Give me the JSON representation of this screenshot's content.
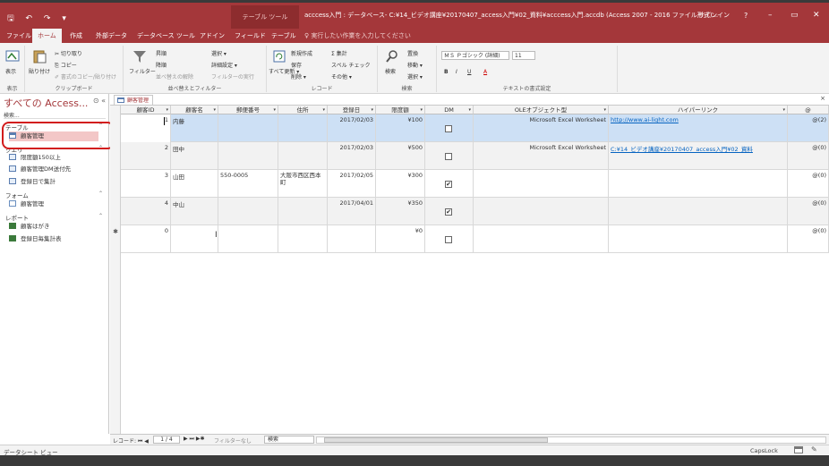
{
  "titlebar": {
    "qat": "🖫 ↶ ↷ ▾",
    "context_tool": "テーブル ツール",
    "title": "acccess入門 : データベース- C:¥14_ビデオ講座¥20170407_access入門¥02_資料¥acccess入門.accdb (Access 2007 - 2016 ファイル形式)...",
    "signin": "サインイン",
    "help": "?",
    "minimize": "–",
    "restore": "▭",
    "close": "✕"
  },
  "tabs": [
    {
      "label": "ファイル"
    },
    {
      "label": "ホーム"
    },
    {
      "label": "作成"
    },
    {
      "label": "外部データ"
    },
    {
      "label": "データベース ツール"
    },
    {
      "label": "アドイン"
    },
    {
      "label": "フィールド"
    },
    {
      "label": "テーブル"
    }
  ],
  "tell_me": "♀ 実行したい作業を入力してください",
  "ribbon": {
    "view": {
      "label": "表示",
      "group": "表示"
    },
    "clipboard": {
      "paste": "貼り付け",
      "cut": "✂ 切り取り",
      "copy": "⎘ コピー",
      "format_painter": "✐ 書式のコピー/貼り付け",
      "group": "クリップボード"
    },
    "sort_filter": {
      "filter": "フィルター",
      "asc": "昇順",
      "desc": "降順",
      "clear_sort": "並べ替えの解除",
      "selection": "選択 ▾",
      "advanced": "詳細設定 ▾",
      "toggle_filter": "フィルターの実行",
      "group": "並べ替えとフィルター"
    },
    "records": {
      "refresh": "すべて更新 ▾",
      "new": "新規作成",
      "save": "保存",
      "delete": "削除 ▾",
      "totals": "Σ 集計",
      "spelling": "スペル チェック",
      "more": "その他 ▾",
      "group": "レコード"
    },
    "find": {
      "find": "検索",
      "replace": "置換",
      "goto": "移動 ▾",
      "select": "選択 ▾",
      "group": "検索"
    },
    "text": {
      "font": "ＭＳ Ｐゴシック (詳細)",
      "size": "11",
      "bold": "B",
      "italic": "I",
      "underline": "U",
      "font_color": "A",
      "group": "テキストの書式設定"
    }
  },
  "nav": {
    "title": "すべての Access...",
    "ctl": "⊙ «",
    "search_placeholder": "検索...",
    "sections": [
      {
        "label": "テーブル",
        "chev": "⌃"
      },
      {
        "label": "クエリ",
        "chev": "⌃"
      },
      {
        "label": "フォーム",
        "chev": "⌃"
      },
      {
        "label": "レポート",
        "chev": "⌃"
      }
    ],
    "items": [
      {
        "label": "顧客管理"
      },
      {
        "label": "限度額150以上"
      },
      {
        "label": "顧客管理DM送付先"
      },
      {
        "label": "登録日で集計"
      },
      {
        "label": "顧客管理"
      },
      {
        "label": "顧客はがき"
      },
      {
        "label": "登録日毎集計表"
      }
    ]
  },
  "doc": {
    "tab": "顧客管理",
    "close": "×"
  },
  "table": {
    "columns": [
      {
        "label": "顧客ID"
      },
      {
        "label": "顧客名"
      },
      {
        "label": "郵便番号"
      },
      {
        "label": "住所"
      },
      {
        "label": "登録日"
      },
      {
        "label": "限度額"
      },
      {
        "label": "DM"
      },
      {
        "label": "OLEオブジェクト型"
      },
      {
        "label": "ハイパーリンク"
      },
      {
        "label": "@"
      }
    ],
    "rows": [
      {
        "id": "1",
        "name": "内藤",
        "zip": "",
        "addr": "",
        "date": "2017/02/03",
        "limit": "¥100",
        "dm": "",
        "ole": "Microsoft Excel Worksheet",
        "link": "http://www.ai-light.com",
        "att": "@(2)"
      },
      {
        "id": "2",
        "name": "田中",
        "zip": "",
        "addr": "",
        "date": "2017/02/03",
        "limit": "¥500",
        "dm": "",
        "ole": "Microsoft Excel Worksheet",
        "link": "C:¥14_ビデオ講座¥20170407_access入門¥02_資料",
        "att": "@(0)"
      },
      {
        "id": "3",
        "name": "山田",
        "zip": "550-0005",
        "addr": "大阪市西区西本町",
        "date": "2017/02/05",
        "limit": "¥300",
        "dm": "✔",
        "ole": "",
        "link": "",
        "att": "@(0)"
      },
      {
        "id": "4",
        "name": "中山",
        "zip": "",
        "addr": "",
        "date": "2017/04/01",
        "limit": "¥350",
        "dm": "✔",
        "ole": "",
        "link": "",
        "att": "@(0)"
      },
      {
        "id": "0",
        "name": "",
        "zip": "",
        "addr": "",
        "date": "",
        "limit": "¥0",
        "dm": "",
        "ole": "",
        "link": "",
        "att": "@(0)",
        "marker": "✱"
      }
    ]
  },
  "recnav": {
    "label": "レコード: ⏮ ◀",
    "position": "1 / 4",
    "next": "▶ ⏭ ▶✱",
    "filter": "フィルターなし",
    "search": "検索"
  },
  "status": {
    "left": "データシート ビュー",
    "caps": "CapsLock"
  },
  "colors": {
    "accent": "#a4373a",
    "selected_row": "#cde0f5",
    "highlight_ring": "#d21c1c"
  }
}
